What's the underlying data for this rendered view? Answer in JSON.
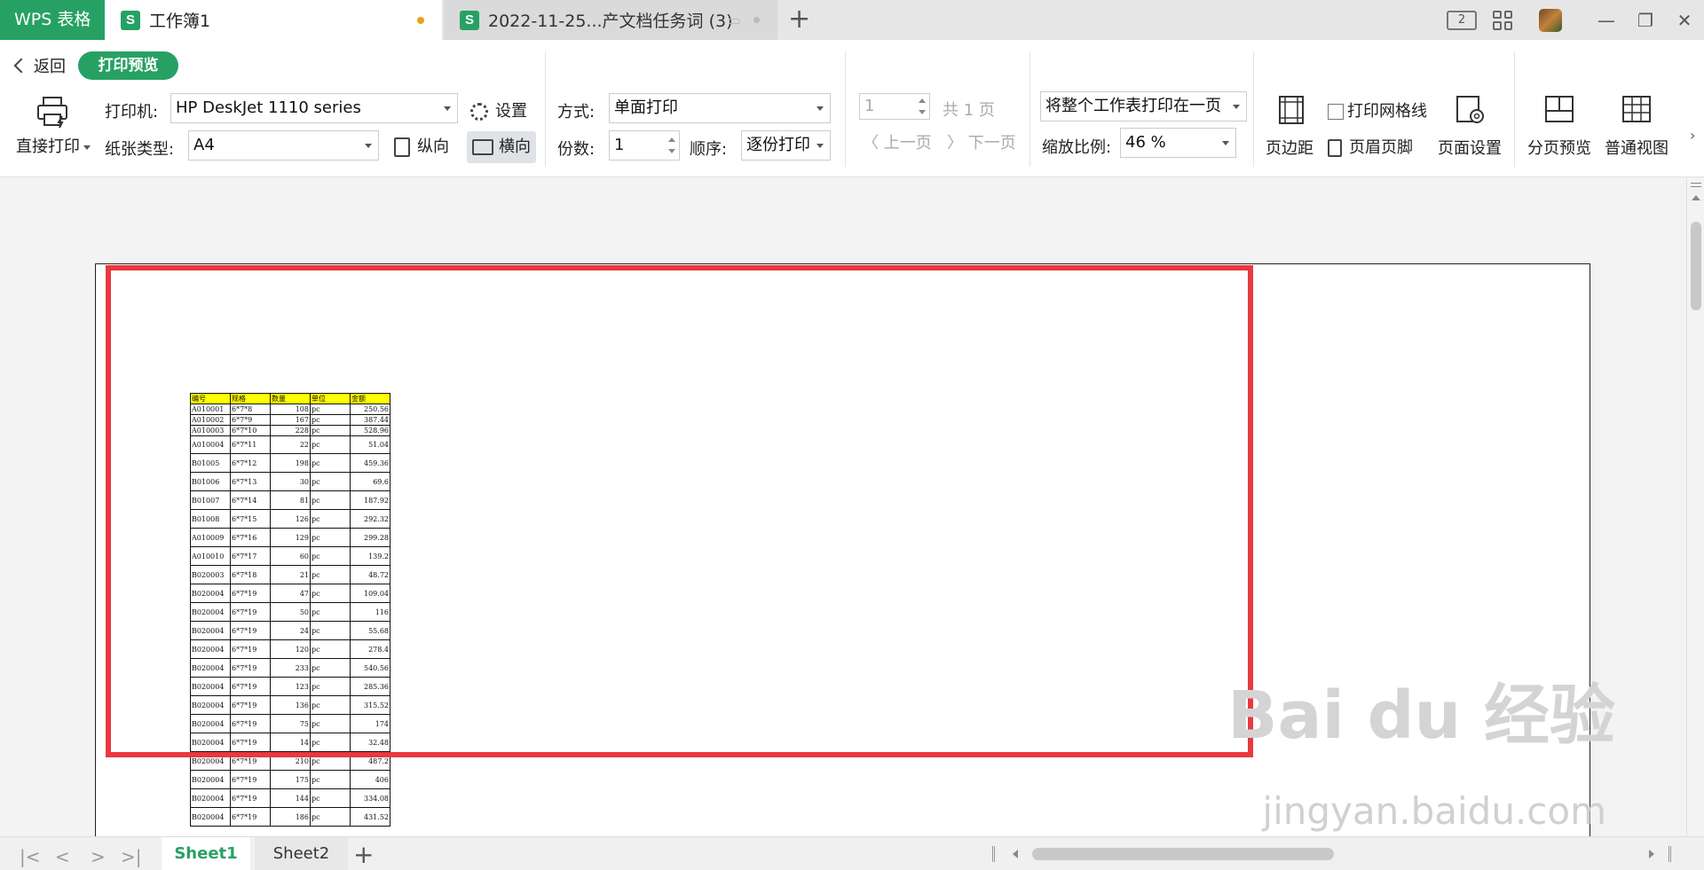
{
  "titlebar": {
    "app_name": "WPS 表格",
    "tabs": [
      {
        "icon": "S",
        "label": "工作簿1"
      },
      {
        "icon": "S",
        "label": "2022-11-25...产文档任务词 (3)"
      }
    ],
    "window_count": "2"
  },
  "toolbar": {
    "back_label": "返回",
    "mode_label": "打印预览",
    "direct_print": "直接打印",
    "printer_label": "打印机:",
    "printer_value": "HP DeskJet 1110 series",
    "settings_label": "设置",
    "paper_label": "纸张类型:",
    "paper_value": "A4",
    "portrait_label": "纵向",
    "landscape_label": "横向",
    "method_label": "方式:",
    "method_value": "单面打印",
    "copies_label": "份数:",
    "copies_value": "1",
    "order_label": "顺序:",
    "order_value": "逐份打印",
    "page_value": "1",
    "page_total": "共 1 页",
    "prev_page": "上一页",
    "next_page": "下一页",
    "fit_value": "将整个工作表打印在一页",
    "scale_label": "缩放比例:",
    "scale_value": "46 %",
    "margins_label": "页边距",
    "gridlines_label": "打印网格线",
    "header_footer_label": "页眉页脚",
    "page_setup_label": "页面设置",
    "page_break_label": "分页预览",
    "normal_view_label": "普通视图"
  },
  "sheet": {
    "headers": [
      "编号",
      "规格",
      "数量",
      "单位",
      "金额"
    ],
    "rows": [
      [
        "A010001",
        "6*7*8",
        "108",
        "pc",
        "250.56"
      ],
      [
        "A010002",
        "6*7*9",
        "167",
        "pc",
        "387.44"
      ],
      [
        "A010003",
        "6*7*10",
        "228",
        "pc",
        "528.96"
      ],
      [
        "A010004",
        "6*7*11",
        "22",
        "pc",
        "51.04"
      ],
      [
        "B01005",
        "6*7*12",
        "198",
        "pc",
        "459.36"
      ],
      [
        "B01006",
        "6*7*13",
        "30",
        "pc",
        "69.6"
      ],
      [
        "B01007",
        "6*7*14",
        "81",
        "pc",
        "187.92"
      ],
      [
        "B01008",
        "6*7*15",
        "126",
        "pc",
        "292.32"
      ],
      [
        "A010009",
        "6*7*16",
        "129",
        "pc",
        "299.28"
      ],
      [
        "A010010",
        "6*7*17",
        "60",
        "pc",
        "139.2"
      ],
      [
        "B020003",
        "6*7*18",
        "21",
        "pc",
        "48.72"
      ],
      [
        "B020004",
        "6*7*19",
        "47",
        "pc",
        "109.04"
      ],
      [
        "B020004",
        "6*7*19",
        "50",
        "pc",
        "116"
      ],
      [
        "B020004",
        "6*7*19",
        "24",
        "pc",
        "55.68"
      ],
      [
        "B020004",
        "6*7*19",
        "120",
        "pc",
        "278.4"
      ],
      [
        "B020004",
        "6*7*19",
        "233",
        "pc",
        "540.56"
      ],
      [
        "B020004",
        "6*7*19",
        "123",
        "pc",
        "285.36"
      ],
      [
        "B020004",
        "6*7*19",
        "136",
        "pc",
        "315.52"
      ],
      [
        "B020004",
        "6*7*19",
        "75",
        "pc",
        "174"
      ],
      [
        "B020004",
        "6*7*19",
        "14",
        "pc",
        "32.48"
      ],
      [
        "B020004",
        "6*7*19",
        "210",
        "pc",
        "487.2"
      ],
      [
        "B020004",
        "6*7*19",
        "175",
        "pc",
        "406"
      ],
      [
        "B020004",
        "6*7*19",
        "144",
        "pc",
        "334.08"
      ],
      [
        "B020004",
        "6*7*19",
        "186",
        "pc",
        "431.52"
      ]
    ]
  },
  "watermark": {
    "text": "Bai du 经验",
    "url": "jingyan.baidu.com"
  },
  "sheetbar": {
    "tabs": [
      "Sheet1",
      "Sheet2"
    ]
  },
  "colors": {
    "brand": "#27a163",
    "highlight": "#e9383f",
    "header_fill": "#ffff00"
  }
}
